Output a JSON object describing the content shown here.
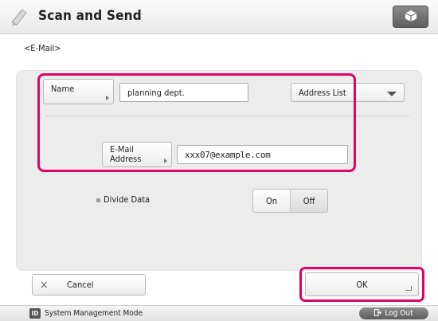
{
  "header": {
    "title": "Scan and Send",
    "icon": "scan-send-icon",
    "right_button_icon": "cube-icon"
  },
  "subtitle": "<E-Mail>",
  "form": {
    "name_button_label": "Name",
    "name_value": "planning dept.",
    "address_list_label": "Address List",
    "email_button_label_line1": "E-Mail",
    "email_button_label_line2": "Address",
    "email_value": "xxx07@example.com",
    "divide_data_label": "Divide Data",
    "on_label": "On",
    "off_label": "Off"
  },
  "footer": {
    "cancel_label": "Cancel",
    "ok_label": "OK"
  },
  "statusbar": {
    "mode_icon_text": "ID",
    "mode_text": "System Management Mode",
    "logout_label": "Log Out"
  },
  "colors": {
    "highlight": "#e2006a",
    "panel": "#ececec"
  }
}
